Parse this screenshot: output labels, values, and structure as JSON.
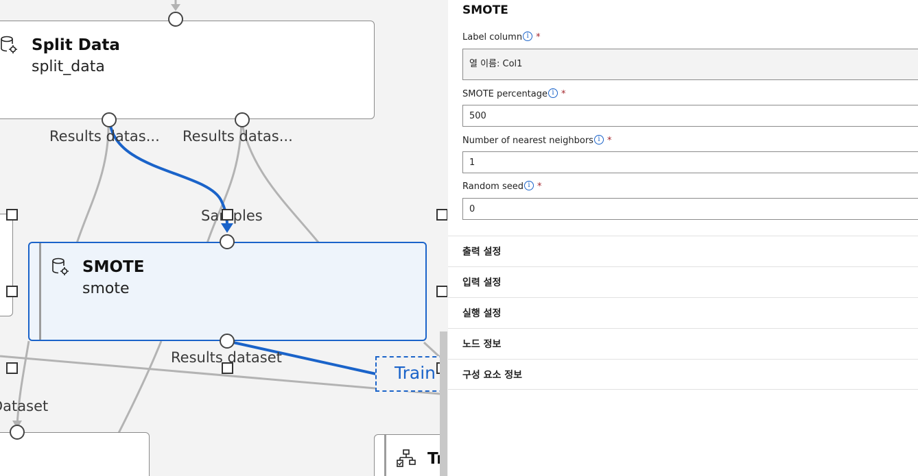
{
  "canvas": {
    "split_node": {
      "title": "Split Data",
      "name": "split_data"
    },
    "smote_node": {
      "title": "SMOTE",
      "name": "smote"
    },
    "ports": {
      "results_1": "Results datas...",
      "results_2": "Results datas...",
      "samples": "Samples",
      "results_dataset": "Results dataset",
      "dataset": "Dataset"
    },
    "train_box": "Train",
    "train_node_partial": "Tr"
  },
  "panel": {
    "title": "SMOTE",
    "fields": [
      {
        "label": "Label column",
        "value": "열 이름: Col1",
        "required": "*"
      },
      {
        "label": "SMOTE percentage",
        "value": "500",
        "required": "*"
      },
      {
        "label": "Number of nearest neighbors",
        "value": "1",
        "required": "*"
      },
      {
        "label": "Random seed",
        "value": "0",
        "required": "*"
      }
    ],
    "sections": [
      "출력 설정",
      "입력 설정",
      "실행 설정",
      "노드 정보",
      "구성 요소 정보"
    ]
  },
  "colors": {
    "accent": "#1a63c9",
    "required": "#a4262c",
    "wire": "#b3b3b3"
  },
  "icons": {
    "dataset_module": "database-gear-icon",
    "train_module": "hierarchy-icon",
    "info": "info-icon"
  }
}
